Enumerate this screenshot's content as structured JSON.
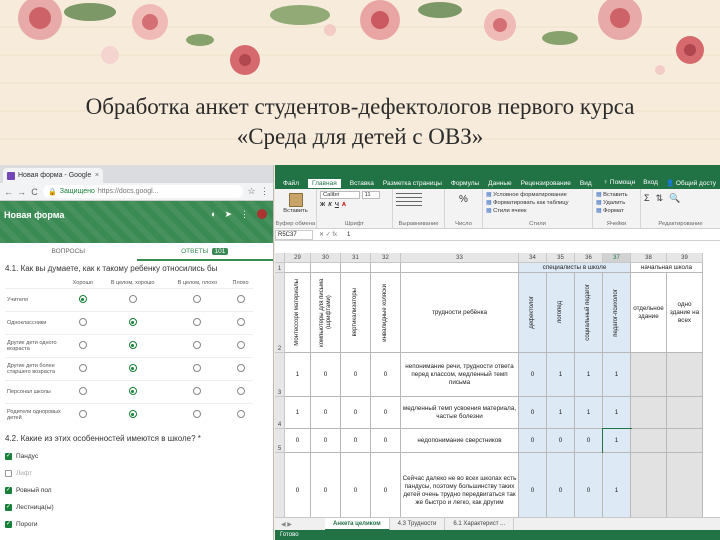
{
  "slide": {
    "title_line1": "Обработка анкет студентов-дефектологов первого курса",
    "title_line2": "«Среда для детей с ОВЗ»"
  },
  "browser": {
    "tab_title": "Новая форма - Google",
    "tab_close": "×",
    "back": "←",
    "forward": "→",
    "reload": "C",
    "secure_label": "Защищено",
    "url": "https://docs.googl...",
    "star": "☆",
    "menu": "⋮"
  },
  "form": {
    "title": "Новая форма",
    "tab_questions": "ВОПРОСЫ",
    "tab_answers": "ОТВЕТЫ",
    "answers_count": "101",
    "q1": {
      "title": "4.1. Как вы думаете, как к такому ребенку относились бы",
      "columns": [
        "Хорошо",
        "В целом, хорошо",
        "В целом, плохо",
        "Плохо"
      ],
      "rows": [
        {
          "label": "Учителя",
          "selected": 0
        },
        {
          "label": "Одноклассники",
          "selected": 1
        },
        {
          "label": "Другие дети одного возраста",
          "selected": 1
        },
        {
          "label": "Другие дети более старшего возраста",
          "selected": 1
        },
        {
          "label": "Персонал школы",
          "selected": 1
        },
        {
          "label": "Родители одноровых детей",
          "selected": 1
        }
      ]
    },
    "q2": {
      "title": "4.2. Какие из этих особенностей имеются в школе? *",
      "options": [
        {
          "label": "Пандус",
          "checked": true
        },
        {
          "label": "Лифт",
          "checked": false
        },
        {
          "label": "Ровный пол",
          "checked": true
        },
        {
          "label": "Лестница(ы)",
          "checked": true
        },
        {
          "label": "Пороги",
          "checked": true
        }
      ]
    }
  },
  "excel": {
    "ribbon_tabs": [
      "Файл",
      "Главная",
      "Вставка",
      "Разметка страницы",
      "Формулы",
      "Данные",
      "Рецензирование",
      "Вид"
    ],
    "help": "Помощн",
    "login": "Вход",
    "share": "Общий досту",
    "groups": {
      "clipboard": "Буфер обмена",
      "font": "Шрифт",
      "alignment": "Выравнивание",
      "number": "Число",
      "styles": "Стили",
      "cells": "Ячейки",
      "editing": "Редактирование"
    },
    "paste_label": "Вставить",
    "font_name": "Calibri",
    "font_size": "11",
    "bold": "Ж",
    "italic": "К",
    "underline": "Ч",
    "number_format": "%",
    "style_buttons": [
      "Условное форматирование",
      "Форматировать как таблицу",
      "Стили ячеек"
    ],
    "cell_buttons": [
      "Вставить",
      "Удалить",
      "Формат"
    ],
    "name_box": "R5C37",
    "fx": "✕ ✓ fx",
    "formula_value": "1",
    "col_headers": [
      "29",
      "30",
      "31",
      "32",
      "33",
      "34",
      "35",
      "36",
      "37",
      "38",
      "39"
    ],
    "row_headers": [
      "1",
      "2",
      "3",
      "4",
      "5",
      "6"
    ],
    "group_header_specialists": "специалисты в школе",
    "group_header_primary": "начальная школа",
    "headers": {
      "c29": "Монтессори материалы",
      "c30": "компьютеры для письма (шрифтами)",
      "c31": "вертикализаторы",
      "c32": "инвалидные коляски",
      "c33": "трудности ребёнка",
      "c34": "дефектолог",
      "c35": "логопед",
      "c36": "социальный педагог",
      "c37": "педагог-психолог",
      "c38": "отдельное здание",
      "c39": "одно здание на всех"
    },
    "rows": [
      {
        "v": [
          "1",
          "0",
          "0",
          "0"
        ],
        "text": "непонимание речи, трудности ответа перед классом, медленный темп письма",
        "s": [
          "0",
          "1",
          "1",
          "1"
        ]
      },
      {
        "v": [
          "1",
          "0",
          "0",
          "0"
        ],
        "text": "медленный темп усвоения материала, частые болезни",
        "s": [
          "0",
          "1",
          "1",
          "1"
        ]
      },
      {
        "v": [
          "0",
          "0",
          "0",
          "0"
        ],
        "text": "недопонимание сверстников",
        "s": [
          "0",
          "0",
          "0",
          "1"
        ]
      },
      {
        "v": [
          "0",
          "0",
          "0",
          "0"
        ],
        "text": "Сейчас далеко не во всех школах есть пандусы, поэтому большинству таких детей очень трудно передвигаться так же быстро и легко, как другим",
        "s": [
          "0",
          "0",
          "0",
          "1"
        ]
      }
    ],
    "sheet_tabs": [
      "Анкета целиком",
      "4.3 Трудности",
      "6.1 Характерист ..."
    ],
    "sheet_nav": "◀ ▶",
    "status": "Готово"
  }
}
